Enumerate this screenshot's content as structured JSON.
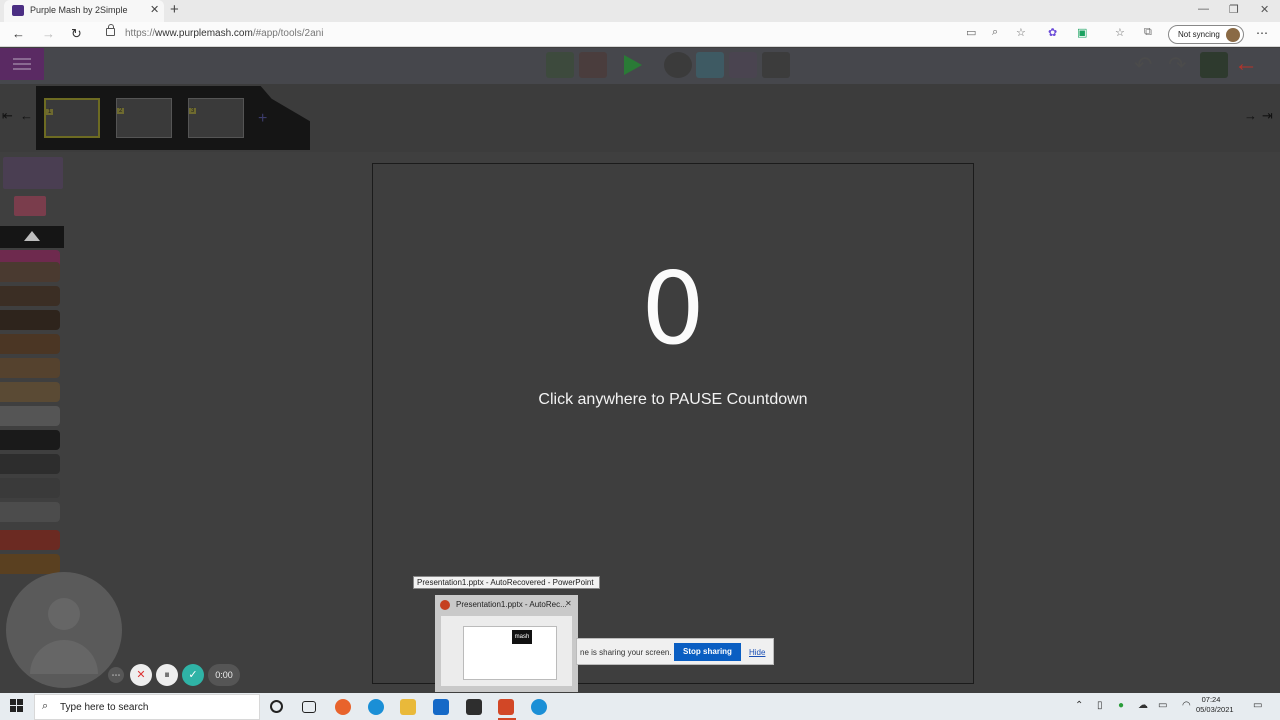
{
  "browser": {
    "tab_title": "Purple Mash by 2Simple",
    "close_tab": "✕",
    "new_tab": "+",
    "url_prefix": "https://",
    "url_domain": "www.purplemash.com",
    "url_path": "/#app/tools/2ani",
    "sync_label": "Not syncing",
    "window_controls": {
      "minimize": "—",
      "restore": "❐",
      "close": "✕"
    },
    "nav": {
      "back": "←",
      "forward": "→",
      "refresh": "↻"
    },
    "toolbar_icons": [
      "camera-icon",
      "zoom-icon",
      "favorite-add-icon",
      "extension-icon",
      "grammarly-icon",
      "favorites-icon",
      "collections-icon"
    ],
    "more": "⋯"
  },
  "app": {
    "countdown": "0",
    "pause_text": "Click anywhere to PAUSE Countdown",
    "frames": [
      "1",
      "2",
      "3"
    ],
    "add_frame": "+",
    "scroll": {
      "left_first": "⇤",
      "left": "←",
      "right": "→",
      "right_last": "⇥"
    }
  },
  "recording": {
    "more": "⋯",
    "cancel": "✕",
    "pause": "⏸",
    "confirm": "✓",
    "timer": "0:00"
  },
  "powerpoint_preview": {
    "tooltip": "Presentation1.pptx  -  AutoRecovered - PowerPoint",
    "title": "Presentation1.pptx  -  AutoRec...",
    "close": "✕",
    "slide_logo": "mash"
  },
  "screen_share": {
    "message": "ne is sharing your screen.",
    "stop_label": "Stop sharing",
    "hide_label": "Hide"
  },
  "taskbar": {
    "search_placeholder": "Type here to search",
    "time": "07:24",
    "date": "05/03/2021"
  }
}
